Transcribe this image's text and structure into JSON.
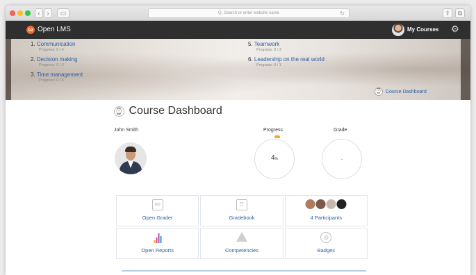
{
  "browser": {
    "address_placeholder": "Q, Search or enter website name",
    "back": "‹",
    "forward": "›"
  },
  "header": {
    "brand": "Open LMS",
    "logo_glyph": "ω",
    "user_menu": "My Courses",
    "settings_icon": "gear-icon"
  },
  "courses": [
    {
      "num": "1.",
      "name": "Communication",
      "progress": "Progress: 0 / 4"
    },
    {
      "num": "2.",
      "name": "Decision making",
      "progress": "Progress: 0 / 3"
    },
    {
      "num": "3.",
      "name": "Time management",
      "progress": "Progress: 0 / 6"
    },
    {
      "num": "5.",
      "name": "Teamwork",
      "progress": "Progress: 0 / 3"
    },
    {
      "num": "6.",
      "name": "Leadership on the real world",
      "progress": "Progress: 0 / 1"
    }
  ],
  "banner_link": "Course Dashboard",
  "page": {
    "title": "Course Dashboard",
    "user_name": "John Smith",
    "progress_label": "Progress",
    "progress_value": "4",
    "progress_unit": "%",
    "progress_fraction": 0.04,
    "grade_label": "Grade",
    "grade_value": "-"
  },
  "tiles": [
    {
      "label": "Open Grader",
      "icon": "grader-icon"
    },
    {
      "label": "Gradebook",
      "icon": "gradebook-icon"
    },
    {
      "label": "4 Participants",
      "icon": "participants-avatars"
    },
    {
      "label": "Open Reports",
      "icon": "reports-chart-icon"
    },
    {
      "label": "Competencies",
      "icon": "competencies-icon"
    },
    {
      "label": "Badges",
      "icon": "badge-icon"
    }
  ],
  "colors": {
    "accent_orange": "#f26a2a",
    "link_blue": "#2c5fa8",
    "topbar": "#2f2f2f"
  }
}
